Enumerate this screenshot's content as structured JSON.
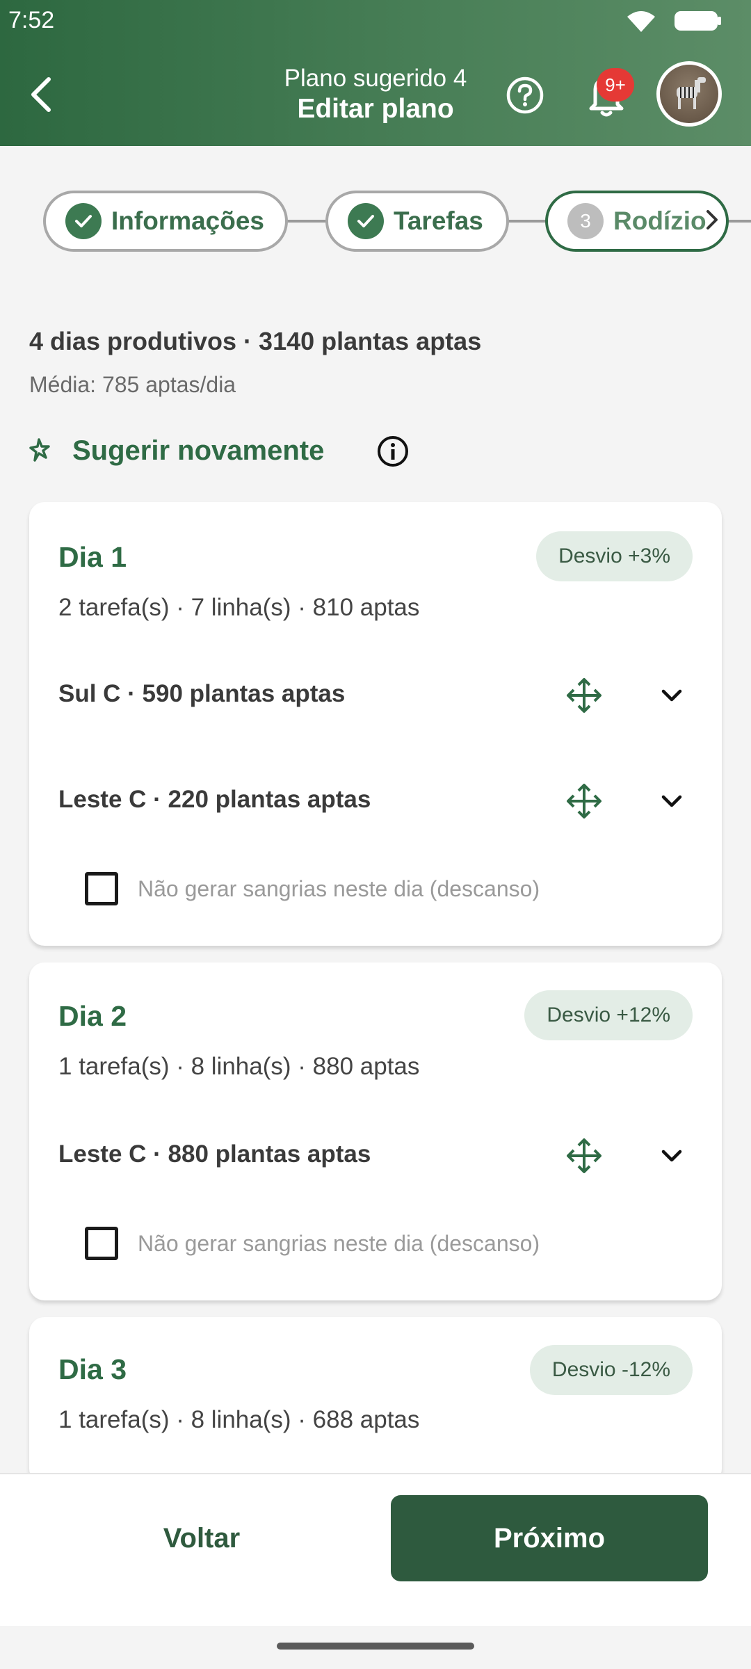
{
  "status_bar": {
    "time": "7:52"
  },
  "header": {
    "subtitle": "Plano sugerido 4",
    "title": "Editar plano",
    "notification_badge": "9+"
  },
  "stepper": {
    "steps": [
      {
        "label": "Informações",
        "state": "done"
      },
      {
        "label": "Tarefas",
        "state": "done"
      },
      {
        "number": "3",
        "label": "Rodízio",
        "state": "active"
      }
    ]
  },
  "summary": {
    "main": "4 dias produtivos · 3140 plantas aptas",
    "average": "Média: 785 aptas/dia",
    "suggest_again": "Sugerir novamente"
  },
  "days": [
    {
      "title": "Dia 1",
      "deviation": "Desvio +3%",
      "meta": "2 tarefa(s) · 7 linha(s) · 810 aptas",
      "tasks": [
        "Sul C · 590 plantas aptas",
        "Leste C · 220 plantas aptas"
      ],
      "rest_label": "Não gerar sangrias neste dia (descanso)"
    },
    {
      "title": "Dia 2",
      "deviation": "Desvio +12%",
      "meta": "1 tarefa(s) · 8 linha(s) · 880 aptas",
      "tasks": [
        "Leste C · 880 plantas aptas"
      ],
      "rest_label": "Não gerar sangrias neste dia (descanso)"
    },
    {
      "title": "Dia 3",
      "deviation": "Desvio -12%",
      "meta": "1 tarefa(s) · 8 linha(s) · 688 aptas"
    }
  ],
  "footer": {
    "back_label": "Voltar",
    "next_label": "Próximo"
  },
  "colors": {
    "primary": "#2f6b45",
    "primary_dark": "#2e5a3e",
    "badge": "#e53935",
    "chip_bg": "#e3ede6"
  }
}
